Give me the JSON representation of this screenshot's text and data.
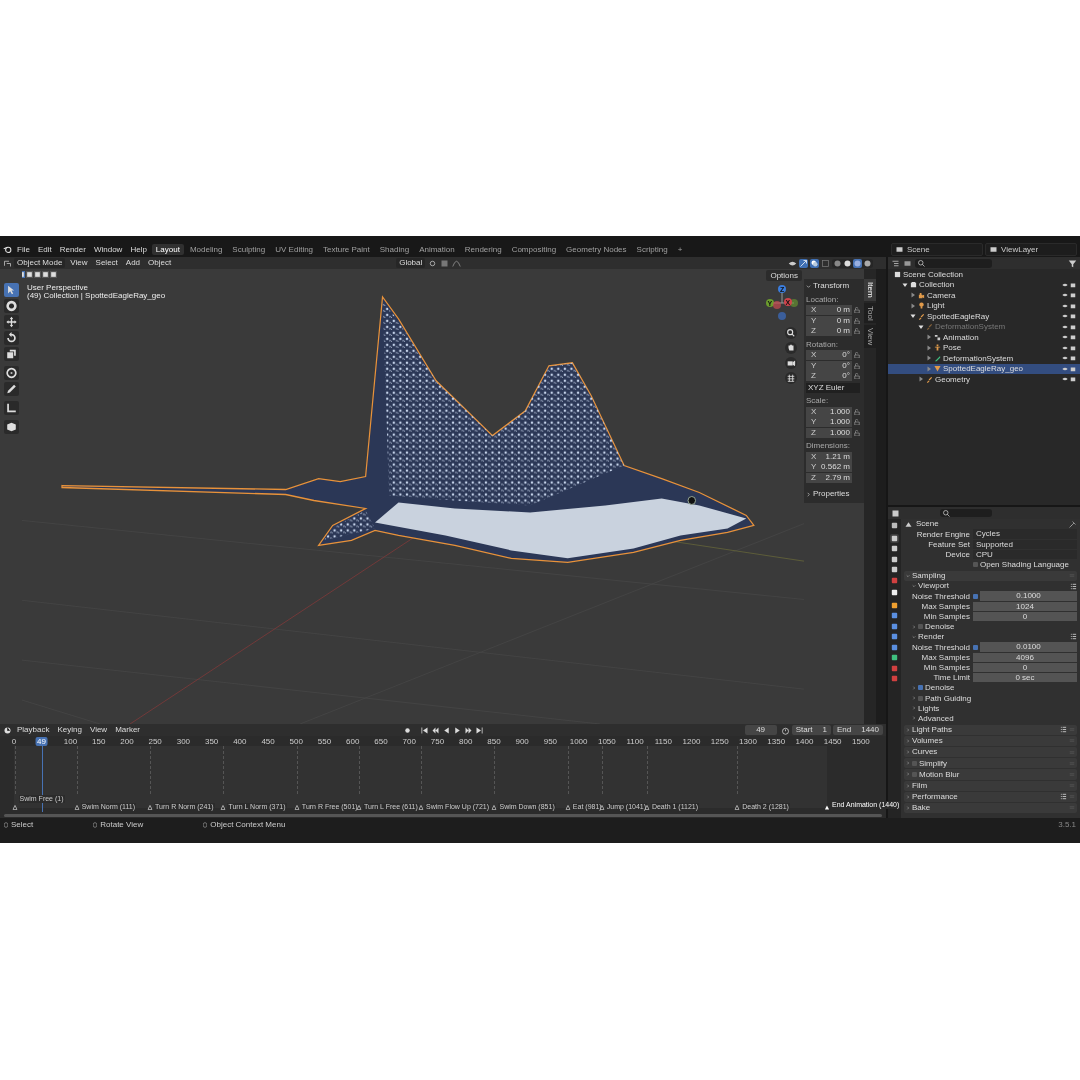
{
  "topbar": {
    "menus": [
      "File",
      "Edit",
      "Render",
      "Window",
      "Help"
    ],
    "workspaces": [
      {
        "label": "Layout",
        "selected": true
      },
      {
        "label": "Modeling",
        "selected": false
      },
      {
        "label": "Sculpting",
        "selected": false
      },
      {
        "label": "UV Editing",
        "selected": false
      },
      {
        "label": "Texture Paint",
        "selected": false
      },
      {
        "label": "Shading",
        "selected": false
      },
      {
        "label": "Animation",
        "selected": false
      },
      {
        "label": "Rendering",
        "selected": false
      },
      {
        "label": "Compositing",
        "selected": false
      },
      {
        "label": "Geometry Nodes",
        "selected": false
      },
      {
        "label": "Scripting",
        "selected": false
      }
    ],
    "add_tab": "+",
    "scene": "Scene",
    "view_layer": "ViewLayer"
  },
  "viewport": {
    "mode": "Object Mode",
    "menus": [
      "View",
      "Select",
      "Add",
      "Object"
    ],
    "orientation": "Global",
    "options": "Options",
    "view_name": "User Perspective",
    "context": "(49) Collection | SpottedEagleRay_geo",
    "gizmo_axes": [
      "Z",
      "Y",
      "X"
    ],
    "select_modes": [
      {
        "selected": true
      },
      {
        "selected": false
      },
      {
        "selected": false
      },
      {
        "selected": false
      },
      {
        "selected": false
      }
    ],
    "shading_modes": [
      {
        "kind": "wireframe",
        "selected": false
      },
      {
        "kind": "solid",
        "selected": false
      },
      {
        "kind": "material",
        "selected": true
      },
      {
        "kind": "rendered",
        "selected": false
      }
    ],
    "tools": [
      {
        "kind": "select",
        "selected": true
      },
      {
        "kind": "cursor",
        "selected": false
      },
      {
        "kind": "move",
        "selected": false
      },
      {
        "kind": "rotate",
        "selected": false
      },
      {
        "kind": "scale",
        "selected": false
      },
      {
        "kind": "transform",
        "selected": false
      },
      {
        "kind": "annotate",
        "selected": false
      },
      {
        "kind": "measure",
        "selected": false
      },
      {
        "kind": "add-cube",
        "selected": false
      }
    ]
  },
  "sidebar": {
    "tabs": [
      {
        "label": "Item",
        "selected": true
      },
      {
        "label": "Tool",
        "selected": false
      },
      {
        "label": "View",
        "selected": false
      }
    ],
    "panel_title": "Transform",
    "groups": [
      {
        "label": "Location:",
        "kind": "lockable",
        "rows": [
          {
            "axis": "X",
            "value": "0 m"
          },
          {
            "axis": "Y",
            "value": "0 m"
          },
          {
            "axis": "Z",
            "value": "0 m"
          }
        ]
      },
      {
        "label": "Rotation:",
        "kind": "lockable",
        "rows": [
          {
            "axis": "X",
            "value": "0°"
          },
          {
            "axis": "Y",
            "value": "0°"
          },
          {
            "axis": "Z",
            "value": "0°"
          }
        ],
        "mode": "XYZ Euler"
      },
      {
        "label": "Scale:",
        "kind": "lockable",
        "rows": [
          {
            "axis": "X",
            "value": "1.000"
          },
          {
            "axis": "Y",
            "value": "1.000"
          },
          {
            "axis": "Z",
            "value": "1.000"
          }
        ]
      },
      {
        "label": "Dimensions:",
        "kind": "plain",
        "rows": [
          {
            "axis": "X",
            "value": "1.21 m"
          },
          {
            "axis": "Y",
            "value": "0.562 m"
          },
          {
            "axis": "Z",
            "value": "2.79 m"
          }
        ]
      }
    ],
    "properties": "Properties"
  },
  "outliner": {
    "tree": [
      {
        "label": "Scene Collection",
        "kind": "scene-collection",
        "selected": false,
        "disabled": false,
        "children": [
          {
            "label": "Collection",
            "kind": "collection",
            "expanded": true,
            "selected": false,
            "disabled": false,
            "children": [
              {
                "label": "Camera",
                "kind": "camera",
                "expanded": false,
                "selected": false,
                "disabled": false
              },
              {
                "label": "Light",
                "kind": "light",
                "expanded": false,
                "selected": false,
                "disabled": false
              },
              {
                "label": "SpottedEagleRay",
                "kind": "armature",
                "expanded": true,
                "selected": false,
                "disabled": false,
                "children": [
                  {
                    "label": "DeformationSystem",
                    "kind": "armature",
                    "expanded": true,
                    "selected": false,
                    "disabled": true,
                    "children": [
                      {
                        "label": "Animation",
                        "kind": "animation",
                        "expanded": false,
                        "selected": false,
                        "disabled": false
                      },
                      {
                        "label": "Pose",
                        "kind": "pose",
                        "expanded": false,
                        "selected": false,
                        "disabled": false
                      },
                      {
                        "label": "DeformationSystem",
                        "kind": "armature-data",
                        "expanded": false,
                        "selected": false,
                        "disabled": false
                      },
                      {
                        "label": "SpottedEagleRay_geo",
                        "kind": "mesh",
                        "expanded": false,
                        "selected": true,
                        "disabled": false
                      }
                    ]
                  },
                  {
                    "label": "Geometry",
                    "kind": "armature",
                    "expanded": false,
                    "selected": false,
                    "disabled": false
                  }
                ]
              }
            ]
          }
        ]
      }
    ]
  },
  "properties": {
    "tabs": [
      {
        "kind": "tool",
        "selected": false
      },
      {
        "kind": "render",
        "selected": true
      },
      {
        "kind": "output",
        "selected": false
      },
      {
        "kind": "view-layer",
        "selected": false
      },
      {
        "kind": "scene",
        "selected": false
      },
      {
        "kind": "world",
        "selected": false
      },
      {
        "kind": "collection",
        "selected": false
      },
      {
        "kind": "object",
        "selected": false
      },
      {
        "kind": "modifier",
        "selected": false
      },
      {
        "kind": "particles",
        "selected": false
      },
      {
        "kind": "physics",
        "selected": false
      },
      {
        "kind": "constraints",
        "selected": false
      },
      {
        "kind": "data",
        "selected": false
      },
      {
        "kind": "material",
        "selected": false
      },
      {
        "kind": "texture",
        "selected": false
      }
    ],
    "title": "Scene",
    "fields": [
      {
        "label": "Render Engine",
        "value": "Cycles"
      },
      {
        "label": "Feature Set",
        "value": "Supported"
      },
      {
        "label": "Device",
        "value": "CPU"
      }
    ],
    "osl": {
      "label": "Open Shading Language",
      "checked": false
    },
    "sections": [
      {
        "kind": "panel",
        "label": "Sampling",
        "expanded": true,
        "children": [
          {
            "kind": "panel",
            "label": "Viewport",
            "expanded": true,
            "presets": true,
            "rows": [
              {
                "kind": "threshold",
                "label": "Noise Threshold",
                "checked": true,
                "value": "0.1000"
              },
              {
                "kind": "number",
                "label": "Max Samples",
                "value": "1024"
              },
              {
                "kind": "number",
                "label": "Min Samples",
                "value": "0"
              }
            ]
          },
          {
            "kind": "check-panel",
            "label": "Denoise",
            "expanded": false,
            "checked": false
          },
          {
            "kind": "panel",
            "label": "Render",
            "expanded": true,
            "presets": true,
            "rows": [
              {
                "kind": "threshold",
                "label": "Noise Threshold",
                "checked": true,
                "value": "0.0100"
              },
              {
                "kind": "number",
                "label": "Max Samples",
                "value": "4096"
              },
              {
                "kind": "number",
                "label": "Min Samples",
                "value": "0"
              },
              {
                "kind": "number",
                "label": "Time Limit",
                "value": "0 sec"
              }
            ]
          },
          {
            "kind": "check-panel",
            "label": "Denoise",
            "expanded": false,
            "checked": true
          },
          {
            "kind": "check-panel",
            "label": "Path Guiding",
            "expanded": false,
            "checked": false
          },
          {
            "kind": "panel",
            "label": "Lights",
            "expanded": false
          },
          {
            "kind": "panel",
            "label": "Advanced",
            "expanded": false
          }
        ]
      },
      {
        "kind": "panel",
        "label": "Light Paths",
        "expanded": false,
        "presets": true
      },
      {
        "kind": "panel",
        "label": "Volumes",
        "expanded": false
      },
      {
        "kind": "panel",
        "label": "Curves",
        "expanded": false
      },
      {
        "kind": "check-panel",
        "label": "Simplify",
        "expanded": false,
        "checked": false
      },
      {
        "kind": "check-panel",
        "label": "Motion Blur",
        "expanded": false,
        "checked": false
      },
      {
        "kind": "panel",
        "label": "Film",
        "expanded": false
      },
      {
        "kind": "panel",
        "label": "Performance",
        "expanded": false,
        "presets": true
      },
      {
        "kind": "panel",
        "label": "Bake",
        "expanded": false
      }
    ]
  },
  "timeline": {
    "menus": [
      "Playback",
      "Keying",
      "View",
      "Marker"
    ],
    "current_frame": "49",
    "start_label": "Start",
    "start": "1",
    "end_label": "End",
    "end": "1440",
    "ticks": [
      "0",
      "100",
      "150",
      "200",
      "250",
      "300",
      "350",
      "400",
      "450",
      "500",
      "550",
      "600",
      "650",
      "700",
      "750",
      "800",
      "850",
      "900",
      "950",
      "1000",
      "1050",
      "1100",
      "1150",
      "1200",
      "1250",
      "1300",
      "1350",
      "1400",
      "1450",
      "1500"
    ],
    "playhead": "49",
    "markers": [
      "Swim Free (1)",
      "Swim Norm (111)",
      "Turn R Norm (241)",
      "Turn L Norm (371)",
      "Turn R Free (501)",
      "Turn L Free (611)",
      "Swim Flow Up (721)",
      "Swim Down (851)",
      "Eat (981)",
      "Jump (1041)",
      "Death 1 (1121)",
      "Death 2 (1281)"
    ],
    "end_marker": "End Animation (1440)"
  },
  "status_bar": {
    "hints": [
      "Select",
      "Rotate View",
      "Object Context Menu"
    ],
    "version": "3.5.1"
  }
}
